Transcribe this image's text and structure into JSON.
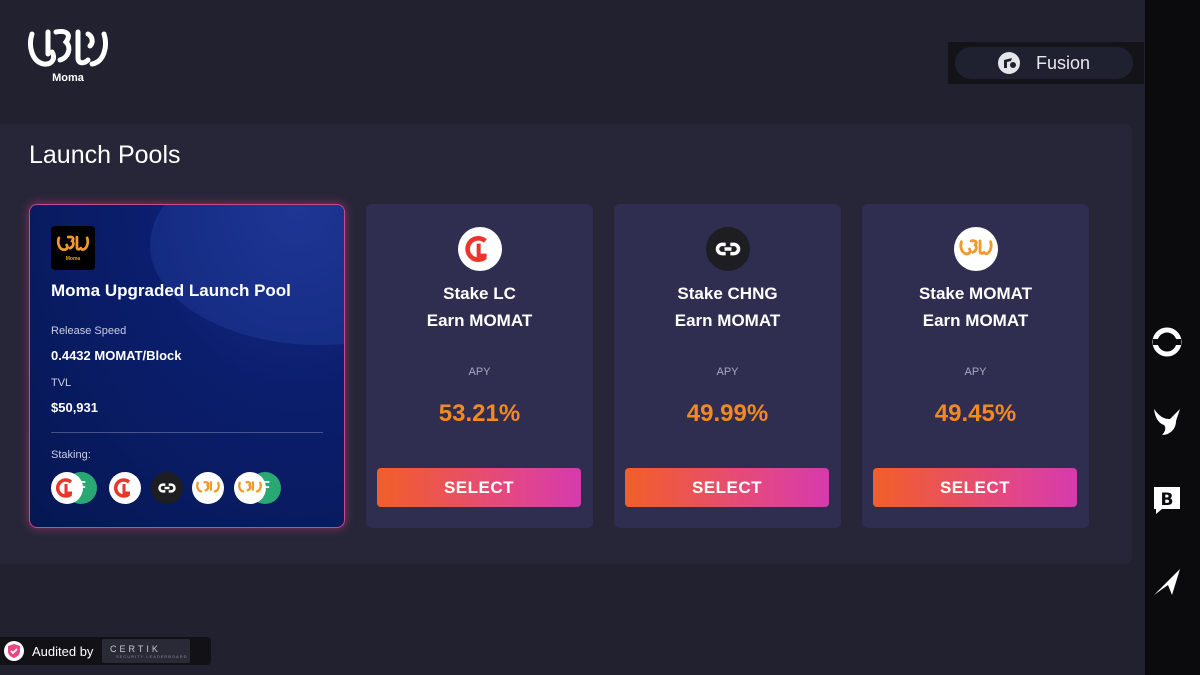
{
  "brand": {
    "name": "Moma"
  },
  "network": {
    "label": "Fusion"
  },
  "page": {
    "title": "Launch Pools"
  },
  "featured_pool": {
    "title": "Moma Upgraded Launch Pool",
    "release_speed_label": "Release Speed",
    "release_speed_value": "0.4432 MOMAT/Block",
    "tvl_label": "TVL",
    "tvl_value": "$50,931",
    "staking_label": "Staking:",
    "staking_tokens": [
      "LC-FSN LP",
      "LC",
      "CHNG",
      "MOMAT",
      "MOMAT-FSN LP"
    ]
  },
  "pools": [
    {
      "stake": "Stake LC",
      "earn": "Earn MOMAT",
      "apy_label": "APY",
      "apy": "53.21%",
      "button": "SELECT",
      "icon": "lc-token-icon"
    },
    {
      "stake": "Stake CHNG",
      "earn": "Earn MOMAT",
      "apy_label": "APY",
      "apy": "49.99%",
      "button": "SELECT",
      "icon": "chng-token-icon"
    },
    {
      "stake": "Stake MOMAT",
      "earn": "Earn MOMAT",
      "apy_label": "APY",
      "apy": "49.45%",
      "button": "SELECT",
      "icon": "momat-token-icon"
    }
  ],
  "audit": {
    "label": "Audited by",
    "auditor": "CERTIK",
    "auditor_sub": "SECURITY LEADERBOARD"
  },
  "rail_icons": [
    "circle-social-icon",
    "bird-social-icon",
    "b-social-icon",
    "arrow-social-icon"
  ],
  "colors": {
    "accent_orange": "#f28a1f",
    "button_start": "#f25f27",
    "button_end": "#d63aad",
    "card_bg": "#2f2d50",
    "featured_bg": "#0b1e6e"
  }
}
